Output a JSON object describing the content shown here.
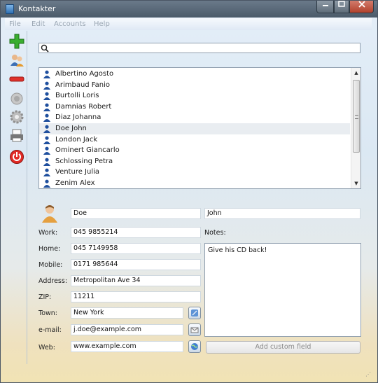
{
  "window": {
    "title": "Kontakter"
  },
  "menu": [
    "File",
    "Edit",
    "Accounts",
    "Help"
  ],
  "toolbar": [
    {
      "icon": "add-contact-icon"
    },
    {
      "icon": "contacts-icon"
    },
    {
      "icon": "remove-contact-icon"
    },
    {
      "icon": "disabled-icon"
    },
    {
      "icon": "settings-icon"
    },
    {
      "icon": "print-icon"
    },
    {
      "icon": "power-icon"
    }
  ],
  "search": {
    "value": "",
    "placeholder": ""
  },
  "contacts": [
    {
      "name": "Albertino Agosto"
    },
    {
      "name": "Arimbaud Fanio"
    },
    {
      "name": "Burtolli Loris"
    },
    {
      "name": "Damnias Robert"
    },
    {
      "name": "Diaz Johanna"
    },
    {
      "name": "Doe John",
      "selected": true
    },
    {
      "name": "London Jack"
    },
    {
      "name": "Ominert Giancarlo"
    },
    {
      "name": "Schlossing Petra"
    },
    {
      "name": "Venture Julia"
    },
    {
      "name": "Zenim Alex"
    }
  ],
  "detail": {
    "last_name": "Doe",
    "first_name": "John",
    "labels": {
      "work": "Work:",
      "home": "Home:",
      "mobile": "Mobile:",
      "address": "Address:",
      "zip": "ZIP:",
      "town": "Town:",
      "email": "e-mail:",
      "web": "Web:",
      "notes": "Notes:"
    },
    "work": "045 9855214",
    "home": "045 7149958",
    "mobile": "0171 985644",
    "address": "Metropolitan Ave 34",
    "zip": "11211",
    "town": "New York",
    "email": "j.doe@example.com",
    "web": "www.example.com",
    "notes": "Give his CD back!",
    "add_custom_field": "Add custom field"
  },
  "colors": {
    "titlebar": "#4b5a69",
    "selection": "#e9edf1",
    "close": "#b2412c"
  }
}
